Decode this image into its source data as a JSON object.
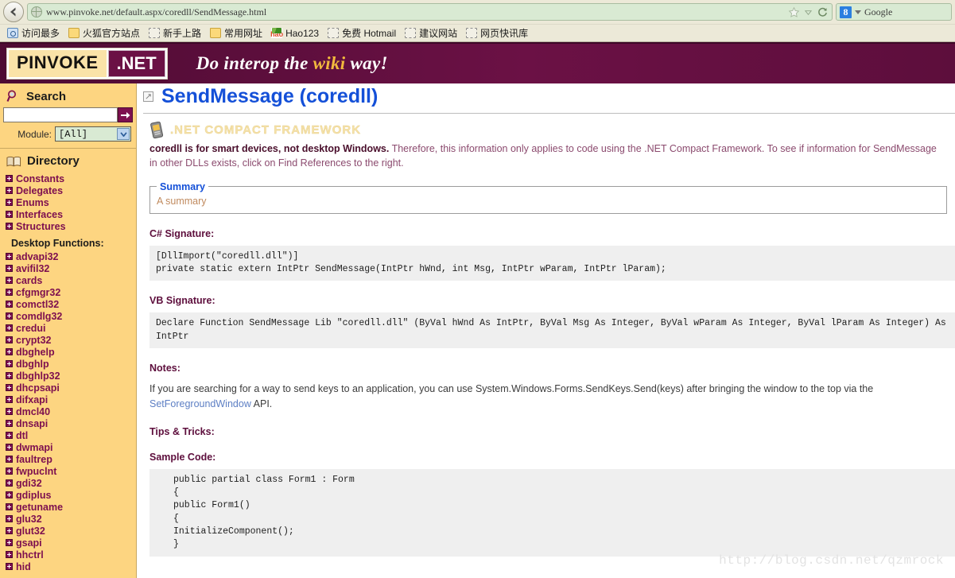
{
  "browser": {
    "url": "www.pinvoke.net/default.aspx/coredll/SendMessage.html",
    "back_label": "Back",
    "bookmark_star": "bookmark-star",
    "reload_label": "Reload",
    "search_engine": "Google",
    "search_engine_badge": "8",
    "bookmarks": [
      {
        "label": "访问最多",
        "icon": "blue-page-icon"
      },
      {
        "label": "火狐官方站点",
        "icon": "folder-icon"
      },
      {
        "label": "新手上路",
        "icon": "dashed-page-icon"
      },
      {
        "label": "常用网址",
        "icon": "folder-icon"
      },
      {
        "label": "Hao123",
        "icon": "hao123-icon"
      },
      {
        "label": "免费 Hotmail",
        "icon": "dashed-page-icon"
      },
      {
        "label": "建议网站",
        "icon": "dashed-page-icon"
      },
      {
        "label": "网页快讯库",
        "icon": "dashed-page-icon"
      }
    ]
  },
  "banner": {
    "logo_primary": "PINVOKE",
    "logo_secondary": ".NET",
    "tagline_before": "Do interop the ",
    "tagline_highlight": "wiki",
    "tagline_after": " way!"
  },
  "sidebar": {
    "search": {
      "heading": "Search",
      "icon": "magnifier-icon",
      "input_value": "",
      "input_placeholder": "",
      "go_label": "go-arrow",
      "module_label": "Module:",
      "module_value": "[All]"
    },
    "directory": {
      "heading": "Directory",
      "icon": "book-icon",
      "items": [
        {
          "label": "Constants"
        },
        {
          "label": "Delegates"
        },
        {
          "label": "Enums"
        },
        {
          "label": "Interfaces"
        },
        {
          "label": "Structures"
        }
      ]
    },
    "desktop_functions": {
      "heading": "Desktop Functions:",
      "items": [
        {
          "label": "advapi32"
        },
        {
          "label": "avifil32"
        },
        {
          "label": "cards"
        },
        {
          "label": "cfgmgr32"
        },
        {
          "label": "comctl32"
        },
        {
          "label": "comdlg32"
        },
        {
          "label": "credui"
        },
        {
          "label": "crypt32"
        },
        {
          "label": "dbghelp"
        },
        {
          "label": "dbghlp"
        },
        {
          "label": "dbghlp32"
        },
        {
          "label": "dhcpsapi"
        },
        {
          "label": "difxapi"
        },
        {
          "label": "dmcl40"
        },
        {
          "label": "dnsapi"
        },
        {
          "label": "dtl"
        },
        {
          "label": "dwmapi"
        },
        {
          "label": "faultrep"
        },
        {
          "label": "fwpuclnt"
        },
        {
          "label": "gdi32"
        },
        {
          "label": "gdiplus"
        },
        {
          "label": "getuname"
        },
        {
          "label": "glu32"
        },
        {
          "label": "glut32"
        },
        {
          "label": "gsapi"
        },
        {
          "label": "hhctrl"
        },
        {
          "label": "hid"
        }
      ]
    }
  },
  "main": {
    "title": "SendMessage (coredll)",
    "compact_framework": {
      "icon": "mobile-device-icon",
      "banner_text": ".NET COMPACT FRAMEWORK",
      "notice_bold": "coredll is for smart devices, not desktop Windows.",
      "notice_rest": " Therefore, this information only applies to code using the .NET Compact Framework. To see if information for SendMessage in other DLLs exists, click on Find References to the right."
    },
    "summary": {
      "legend": "Summary",
      "text": "A summary"
    },
    "csharp": {
      "label": "C# Signature:",
      "code": "[DllImport(\"coredll.dll\")]\nprivate static extern IntPtr SendMessage(IntPtr hWnd, int Msg, IntPtr wParam, IntPtr lParam);"
    },
    "vb": {
      "label": "VB Signature:",
      "code": "Declare Function SendMessage Lib \"coredll.dll\" (ByVal hWnd As IntPtr, ByVal Msg As Integer, ByVal wParam As Integer, ByVal lParam As Integer) As\nIntPtr"
    },
    "notes": {
      "label": "Notes:",
      "text_before": "If you are searching for a way to send keys to an application, you can use System.Windows.Forms.SendKeys.Send(keys) after bringing the window to the top via the ",
      "link_text": "SetForegroundWindow",
      "text_after": " API."
    },
    "tips": {
      "label": "Tips & Tricks:"
    },
    "sample": {
      "label": "Sample Code:",
      "code": "public partial class Form1 : Form\n{\npublic Form1()\n{\nInitializeComponent();\n}"
    },
    "watermark": "http://blog.csdn.net/qzmrock"
  }
}
